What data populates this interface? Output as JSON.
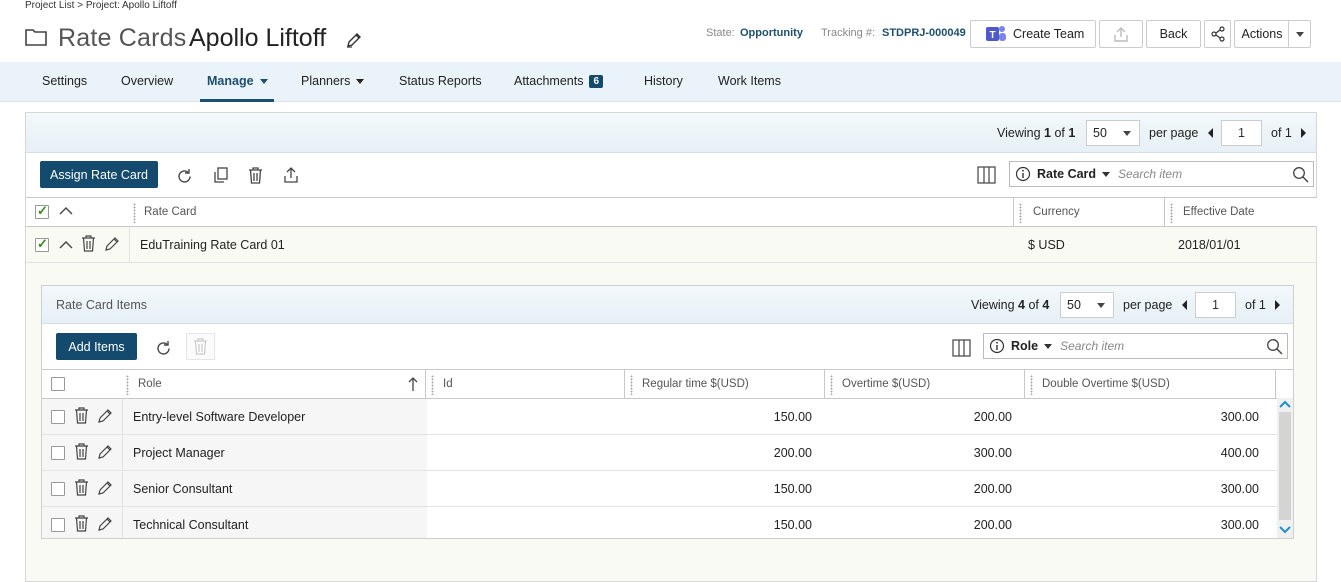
{
  "breadcrumb": "Project List > Project: Apollo Liftoff",
  "header": {
    "title": "Rate Cards",
    "project_name": "Apollo Liftoff",
    "state_label": "State:",
    "state_value": "Opportunity",
    "tracking_label": "Tracking #:",
    "tracking_value": "STDPRJ-000049",
    "create_team_label": "Create Team",
    "back_label": "Back",
    "actions_label": "Actions"
  },
  "nav": {
    "tabs": [
      {
        "label": "Settings"
      },
      {
        "label": "Overview"
      },
      {
        "label": "Manage",
        "active": true
      },
      {
        "label": "Planners"
      },
      {
        "label": "Status Reports"
      },
      {
        "label": "Attachments",
        "badge": "6"
      },
      {
        "label": "History"
      },
      {
        "label": "Work Items"
      }
    ]
  },
  "outer_pager": {
    "viewing_prefix": "Viewing",
    "viewing_current": "1",
    "viewing_of": "of",
    "viewing_total": "1",
    "per_page_value": "50",
    "per_page_label": "per page",
    "page_value": "1",
    "page_of": "of 1"
  },
  "outer_toolbar": {
    "assign_label": "Assign Rate Card",
    "filter_label": "Rate Card",
    "search_placeholder": "Search item"
  },
  "outer_columns": {
    "rate_card": "Rate Card",
    "currency": "Currency",
    "effective_date": "Effective Date"
  },
  "outer_row": {
    "rate_card": "EduTraining Rate Card 01",
    "currency": "$ USD",
    "effective_date": "2018/01/01",
    "checked": true
  },
  "inner_panel": {
    "title": "Rate Card Items",
    "viewing_prefix": "Viewing",
    "viewing_current": "4",
    "viewing_of": "of",
    "viewing_total": "4",
    "per_page_value": "50",
    "per_page_label": "per page",
    "page_value": "1",
    "page_of": "of 1",
    "add_items_label": "Add Items",
    "filter_label": "Role",
    "search_placeholder": "Search item",
    "columns": {
      "role": "Role",
      "id": "Id",
      "regular": "Regular time $(USD)",
      "overtime": "Overtime $(USD)",
      "double_overtime": "Double Overtime $(USD)"
    },
    "rows": [
      {
        "role": "Entry-level Software Developer",
        "id": "",
        "regular": "150.00",
        "overtime": "200.00",
        "double_overtime": "300.00"
      },
      {
        "role": "Project Manager",
        "id": "",
        "regular": "200.00",
        "overtime": "300.00",
        "double_overtime": "400.00"
      },
      {
        "role": "Senior Consultant",
        "id": "",
        "regular": "150.00",
        "overtime": "200.00",
        "double_overtime": "300.00"
      },
      {
        "role": "Technical Consultant",
        "id": "",
        "regular": "150.00",
        "overtime": "200.00",
        "double_overtime": "300.00"
      }
    ]
  },
  "colors": {
    "primary": "#134a6e",
    "accent_text": "#1d4f6e",
    "nav_background": "#eaf3f9",
    "check_green": "#3c8a1e"
  },
  "icons": [
    "folder-icon",
    "pencil-icon",
    "teams-icon",
    "upload-icon",
    "share-icon",
    "refresh-icon",
    "copy-icon",
    "trash-icon",
    "export-icon",
    "columns-icon",
    "info-icon",
    "search-icon",
    "sort-up-icon",
    "chevron-up-icon",
    "chevron-down-icon"
  ]
}
